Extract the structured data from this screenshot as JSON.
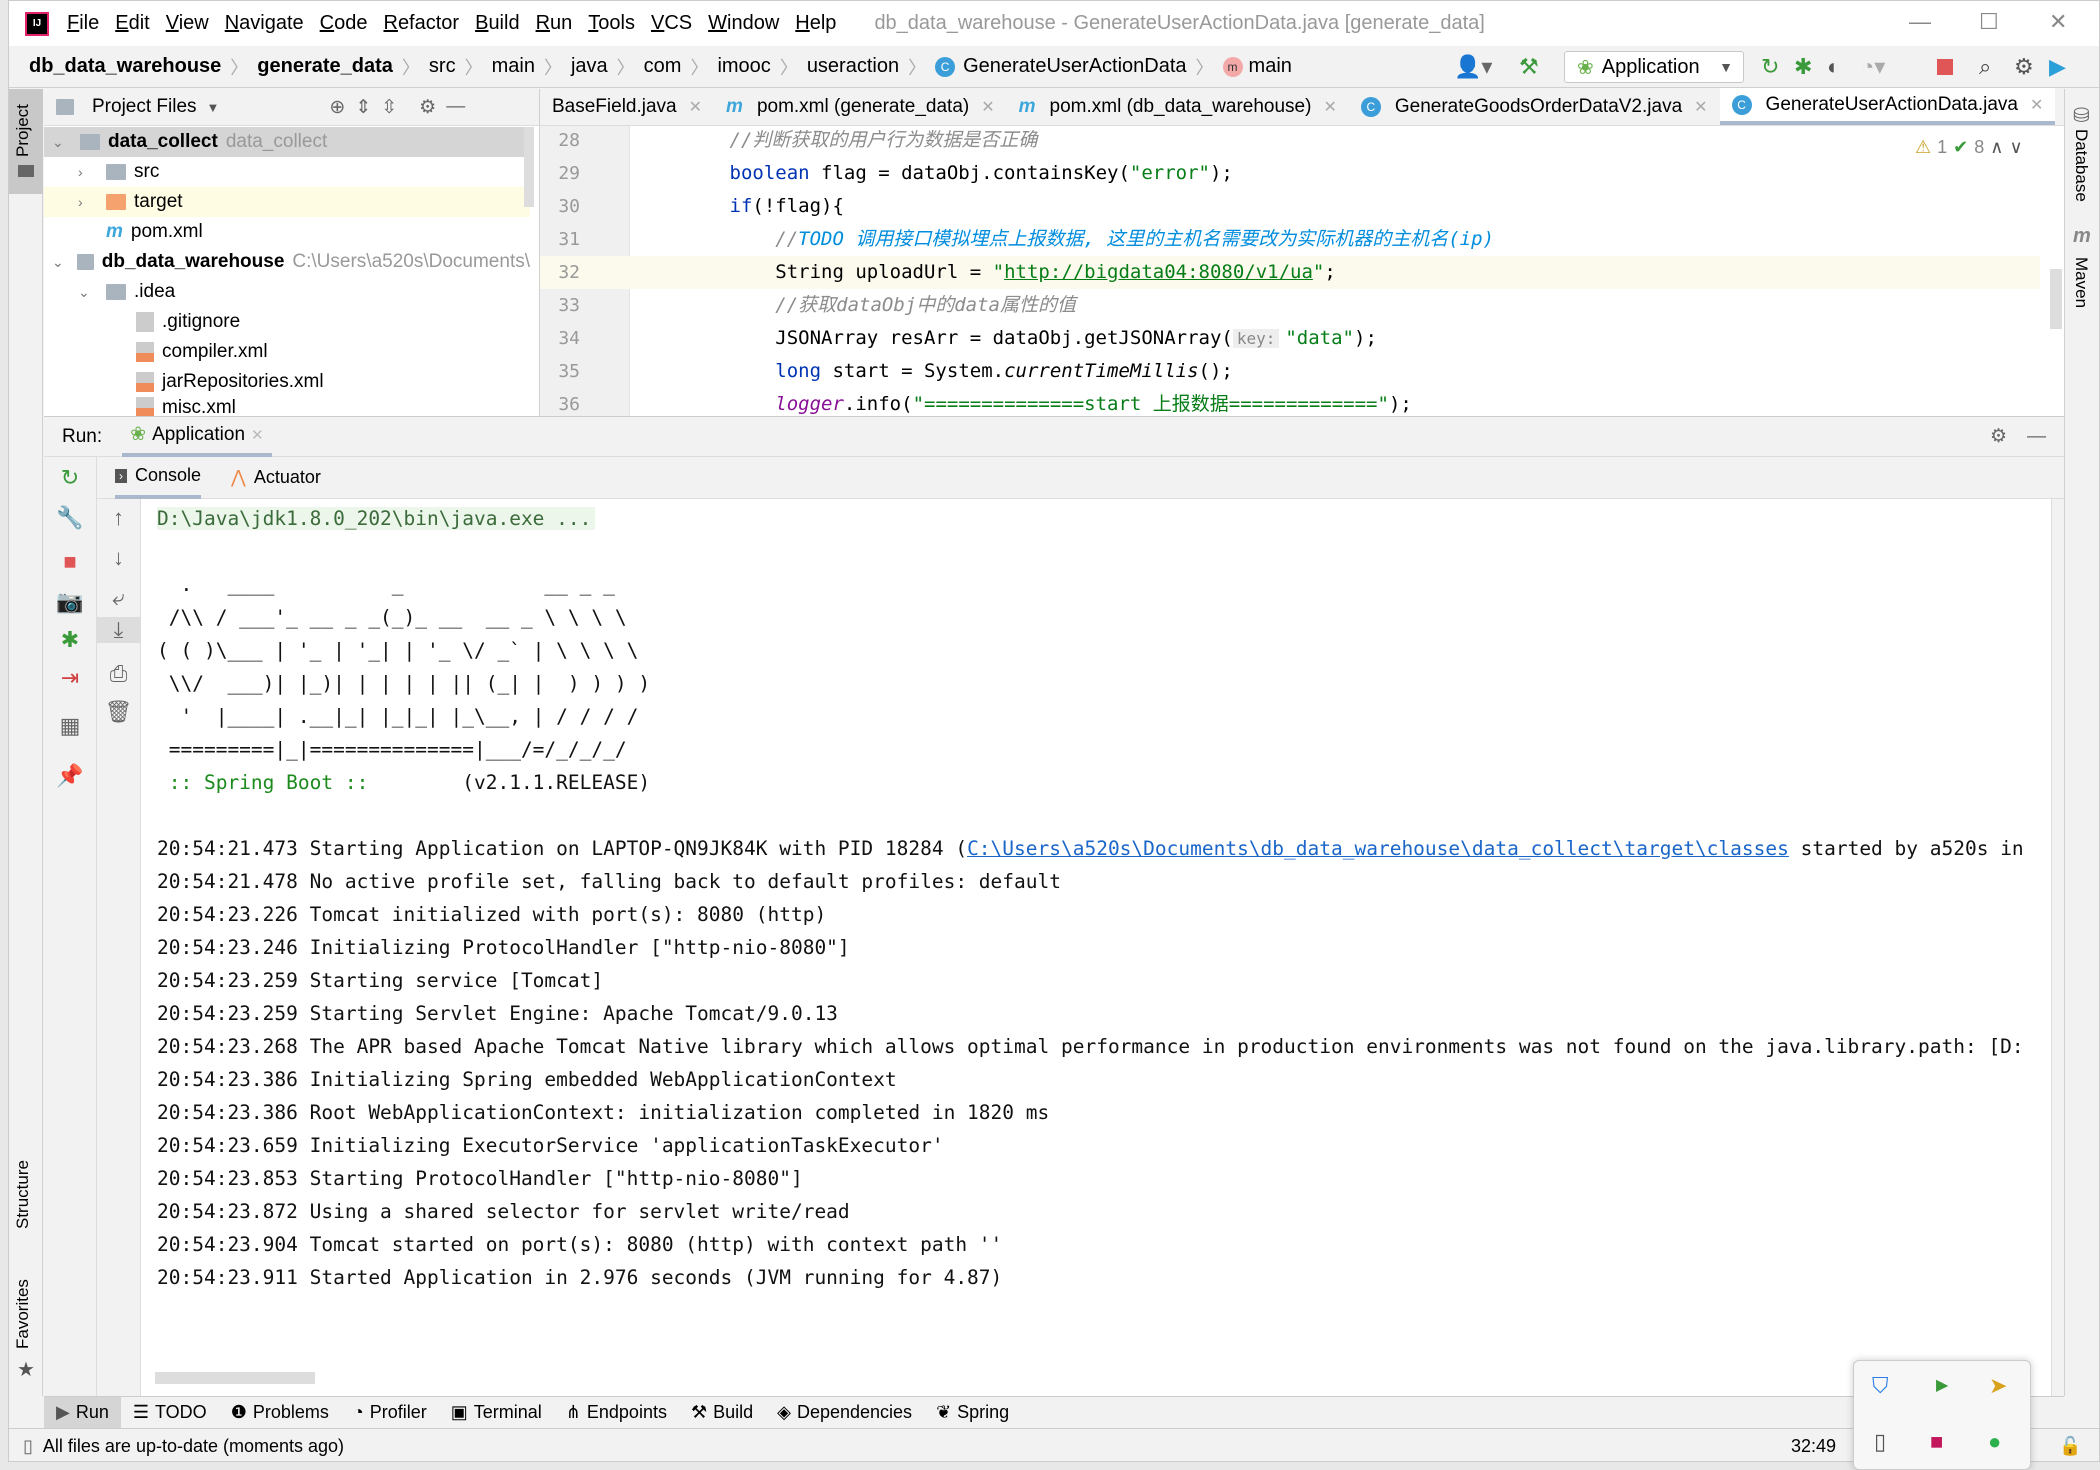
{
  "window": {
    "title": "db_data_warehouse - GenerateUserActionData.java [generate_data]",
    "menu": [
      "File",
      "Edit",
      "View",
      "Navigate",
      "Code",
      "Refactor",
      "Build",
      "Run",
      "Tools",
      "VCS",
      "Window",
      "Help"
    ]
  },
  "breadcrumb": [
    "db_data_warehouse",
    "generate_data",
    "src",
    "main",
    "java",
    "com",
    "imooc",
    "useraction",
    "GenerateUserActionData",
    "main"
  ],
  "toolbar": {
    "run_config": "Application"
  },
  "project": {
    "header": "Project Files",
    "side_tab": "Project",
    "tree": [
      {
        "label": "data_collect",
        "hint": "data_collect",
        "type": "module",
        "expanded": true
      },
      {
        "label": "src",
        "type": "folder"
      },
      {
        "label": "target",
        "type": "folder-excluded"
      },
      {
        "label": "pom.xml",
        "type": "maven"
      },
      {
        "label": "db_data_warehouse",
        "hint": "C:\\Users\\a520s\\Documents\\",
        "type": "module",
        "expanded": true
      },
      {
        "label": ".idea",
        "type": "folder",
        "expanded": true
      },
      {
        "label": ".gitignore",
        "type": "ignore"
      },
      {
        "label": "compiler.xml",
        "type": "xml"
      },
      {
        "label": "jarRepositories.xml",
        "type": "xml"
      },
      {
        "label": "misc.xml",
        "type": "xml"
      }
    ]
  },
  "editor": {
    "tabs": [
      {
        "label": "BaseField.java",
        "icon": "none"
      },
      {
        "label": "pom.xml (generate_data)",
        "icon": "maven"
      },
      {
        "label": "pom.xml (db_data_warehouse)",
        "icon": "maven"
      },
      {
        "label": "GenerateGoodsOrderDataV2.java",
        "icon": "class"
      },
      {
        "label": "GenerateUserActionData.java",
        "icon": "class",
        "active": true
      }
    ],
    "inspections": {
      "warnings": "1",
      "ok": "8"
    },
    "lines": [
      {
        "n": "28",
        "tokens": [
          [
            "        ",
            ""
          ],
          [
            "//判断获取的用户行为数据是否正确",
            "c"
          ]
        ]
      },
      {
        "n": "29",
        "tokens": [
          [
            "        ",
            ""
          ],
          [
            "boolean",
            "k"
          ],
          [
            " flag = dataObj.containsKey(",
            ""
          ],
          [
            "\"error\"",
            "s"
          ],
          [
            ");",
            ""
          ]
        ]
      },
      {
        "n": "30",
        "tokens": [
          [
            "        ",
            ""
          ],
          [
            "if",
            "k"
          ],
          [
            "(!flag){",
            ""
          ]
        ]
      },
      {
        "n": "31",
        "tokens": [
          [
            "            ",
            ""
          ],
          [
            "//",
            "c"
          ],
          [
            "TODO 调用接口模拟埋点上报数据, 这里的主机名需要改为实际机器的主机名(ip)",
            "todo"
          ]
        ]
      },
      {
        "n": "32",
        "tokens": [
          [
            "            String uploadUrl = ",
            ""
          ],
          [
            "\"",
            "s"
          ],
          [
            "http://bigdata04:8080/v1/ua",
            "s u"
          ],
          [
            "\"",
            "s"
          ],
          [
            ";",
            ""
          ]
        ]
      },
      {
        "n": "33",
        "tokens": [
          [
            "            ",
            ""
          ],
          [
            "//获取dataObj中的data属性的值",
            "c"
          ]
        ]
      },
      {
        "n": "34",
        "tokens": [
          [
            "            JSONArray resArr = dataObj.getJSONArray(",
            ""
          ],
          [
            "key:",
            "hint"
          ],
          [
            "\"data\"",
            "s"
          ],
          [
            ");",
            ""
          ]
        ]
      },
      {
        "n": "35",
        "tokens": [
          [
            "            ",
            ""
          ],
          [
            "long",
            "k"
          ],
          [
            " start = System.",
            ""
          ],
          [
            "currentTimeMillis",
            "f"
          ],
          [
            "();",
            ""
          ]
        ]
      },
      {
        "n": "36",
        "tokens": [
          [
            "            ",
            ""
          ],
          [
            "logger",
            "m"
          ],
          [
            ".info(",
            ""
          ],
          [
            "\"==============start 上报数据=============\"",
            "s"
          ],
          [
            ");",
            ""
          ]
        ]
      }
    ]
  },
  "right_strip": {
    "database": "Database",
    "maven": "Maven"
  },
  "run": {
    "label": "Run:",
    "tab": "Application",
    "subtabs": [
      "Console",
      "Actuator"
    ],
    "console": [
      {
        "text": "D:\\Java\\jdk1.8.0_202\\bin\\java.exe ...",
        "kind": "cmd"
      },
      {
        "text": "",
        "kind": ""
      },
      {
        "text": "  .   ____          _            __ _ _",
        "kind": ""
      },
      {
        "text": " /\\\\ / ___'_ __ _ _(_)_ __  __ _ \\ \\ \\ \\",
        "kind": ""
      },
      {
        "text": "( ( )\\___ | '_ | '_| | '_ \\/ _` | \\ \\ \\ \\",
        "kind": ""
      },
      {
        "text": " \\\\/  ___)| |_)| | | | | || (_| |  ) ) ) )",
        "kind": ""
      },
      {
        "text": "  '  |____| .__|_| |_|_| |_\\__, | / / / /",
        "kind": ""
      },
      {
        "text": " =========|_|==============|___/=/_/_/_/",
        "kind": ""
      },
      {
        "text": " :: Spring Boot :: ",
        "kind": "green",
        "suffix": "       (v2.1.1.RELEASE)"
      },
      {
        "text": "",
        "kind": ""
      },
      {
        "text": "20:54:21.473 Starting Application on LAPTOP-QN9JK84K with PID 18284 (",
        "kind": "",
        "link": "C:\\Users\\a520s\\Documents\\db_data_warehouse\\data_collect\\target\\classes",
        "suffix": " started by a520s in"
      },
      {
        "text": "20:54:21.478 No active profile set, falling back to default profiles: default",
        "kind": ""
      },
      {
        "text": "20:54:23.226 Tomcat initialized with port(s): 8080 (http)",
        "kind": ""
      },
      {
        "text": "20:54:23.246 Initializing ProtocolHandler [\"http-nio-8080\"]",
        "kind": ""
      },
      {
        "text": "20:54:23.259 Starting service [Tomcat]",
        "kind": ""
      },
      {
        "text": "20:54:23.259 Starting Servlet Engine: Apache Tomcat/9.0.13",
        "kind": ""
      },
      {
        "text": "20:54:23.268 The APR based Apache Tomcat Native library which allows optimal performance in production environments was not found on the java.library.path: [D:",
        "kind": ""
      },
      {
        "text": "20:54:23.386 Initializing Spring embedded WebApplicationContext",
        "kind": ""
      },
      {
        "text": "20:54:23.386 Root WebApplicationContext: initialization completed in 1820 ms",
        "kind": ""
      },
      {
        "text": "20:54:23.659 Initializing ExecutorService 'applicationTaskExecutor'",
        "kind": ""
      },
      {
        "text": "20:54:23.853 Starting ProtocolHandler [\"http-nio-8080\"]",
        "kind": ""
      },
      {
        "text": "20:54:23.872 Using a shared selector for servlet write/read",
        "kind": ""
      },
      {
        "text": "20:54:23.904 Tomcat started on port(s): 8080 (http) with context path ''",
        "kind": ""
      },
      {
        "text": "20:54:23.911 Started Application in 2.976 seconds (JVM running for 4.87)",
        "kind": ""
      }
    ]
  },
  "left_strip": {
    "structure": "Structure",
    "favorites": "Favorites"
  },
  "tool_windows": [
    "Run",
    "TODO",
    "Problems",
    "Profiler",
    "Terminal",
    "Endpoints",
    "Build",
    "Dependencies",
    "Spring"
  ],
  "status": {
    "message": "All files are up-to-date (moments ago)",
    "position": "32:49"
  }
}
